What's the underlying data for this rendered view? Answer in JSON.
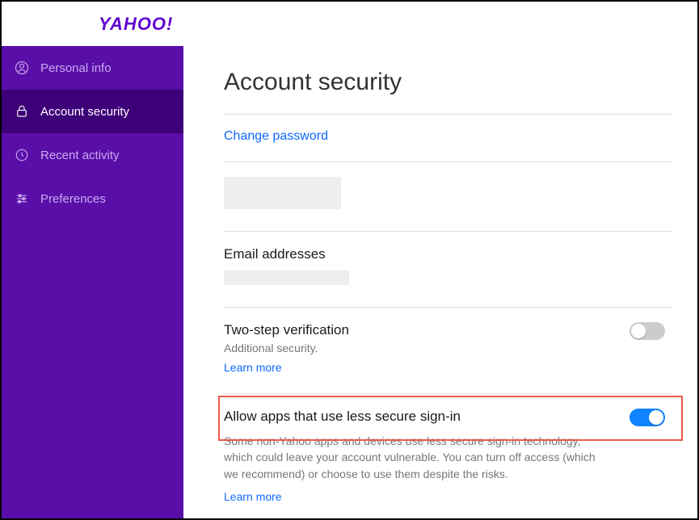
{
  "logo_text": "YAHOO!",
  "sidebar": {
    "items": [
      {
        "label": "Personal info"
      },
      {
        "label": "Account security"
      },
      {
        "label": "Recent activity"
      },
      {
        "label": "Preferences"
      }
    ]
  },
  "page": {
    "title": "Account security"
  },
  "change_password": {
    "label": "Change password"
  },
  "email_section": {
    "heading": "Email addresses"
  },
  "twostep": {
    "heading": "Two-step verification",
    "sub": "Additional security.",
    "learn_more": "Learn more",
    "enabled": false
  },
  "less_secure": {
    "heading": "Allow apps that use less secure sign-in",
    "desc": "Some non-Yahoo apps and devices use less secure sign-in technology, which could leave your account vulnerable. You can turn off access (which we recommend) or choose to use them despite the risks.",
    "learn_more": "Learn more",
    "enabled": true
  }
}
